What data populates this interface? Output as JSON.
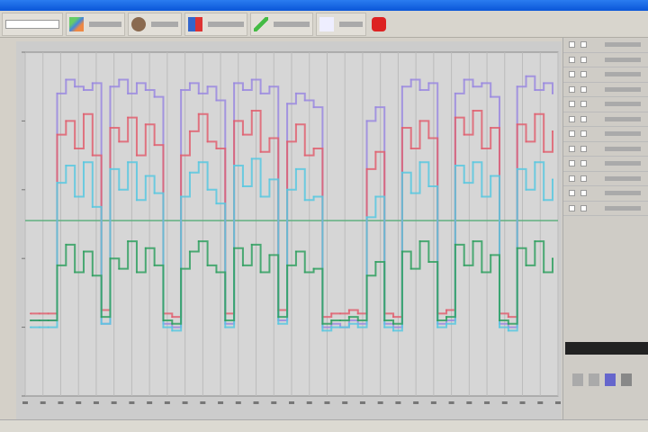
{
  "toolbar": {
    "buttons": [
      {
        "label": "",
        "icon": "chart-add-icon"
      },
      {
        "label": "",
        "icon": "settings-gear-icon"
      },
      {
        "label": "",
        "icon": "channel-graph-icon"
      },
      {
        "label": "",
        "icon": "curve-icon"
      },
      {
        "label": "",
        "icon": "document-icon"
      },
      {
        "label": "",
        "icon": "stop-icon"
      }
    ]
  },
  "colors": {
    "purple": "#9a88e0",
    "red": "#e06070",
    "cyan": "#58c8e0",
    "green": "#30a060",
    "ref": "#60b080"
  },
  "chart_data": {
    "type": "line",
    "title": "",
    "xlabel": "",
    "ylabel": "",
    "ylim": [
      0,
      100
    ],
    "grid": true,
    "x": [
      0,
      1,
      2,
      3,
      4,
      5,
      6,
      7,
      8,
      9,
      10,
      11,
      12,
      13,
      14,
      15,
      16,
      17,
      18,
      19,
      20,
      21,
      22,
      23,
      24,
      25,
      26,
      27,
      28,
      29,
      30,
      31,
      32,
      33,
      34,
      35,
      36,
      37,
      38,
      39,
      40,
      41,
      42,
      43,
      44,
      45,
      46,
      47,
      48,
      49,
      50,
      51,
      52,
      53,
      54,
      55,
      56,
      57,
      58,
      59
    ],
    "reference_line": 51,
    "series": [
      {
        "name": "purple",
        "color": "#9a88e0",
        "values": [
          22,
          22,
          22,
          88,
          92,
          90,
          89,
          91,
          21,
          90,
          92,
          88,
          91,
          89,
          87,
          21,
          20,
          89,
          91,
          88,
          90,
          86,
          21,
          91,
          89,
          92,
          88,
          90,
          22,
          85,
          88,
          86,
          84,
          20,
          21,
          20,
          22,
          21,
          80,
          84,
          21,
          20,
          90,
          92,
          89,
          91,
          21,
          22,
          88,
          92,
          90,
          91,
          87,
          21,
          20,
          90,
          93,
          89,
          91,
          88
        ]
      },
      {
        "name": "red",
        "color": "#e06070",
        "values": [
          24,
          24,
          24,
          76,
          80,
          72,
          82,
          70,
          25,
          78,
          74,
          81,
          70,
          79,
          73,
          24,
          23,
          70,
          77,
          82,
          74,
          72,
          24,
          80,
          76,
          83,
          71,
          75,
          25,
          74,
          79,
          70,
          72,
          23,
          24,
          24,
          25,
          24,
          66,
          71,
          24,
          23,
          78,
          72,
          80,
          75,
          24,
          25,
          81,
          76,
          83,
          72,
          78,
          24,
          23,
          79,
          74,
          82,
          71,
          77
        ]
      },
      {
        "name": "cyan",
        "color": "#58c8e0",
        "values": [
          20,
          20,
          20,
          62,
          67,
          58,
          68,
          55,
          21,
          66,
          60,
          68,
          57,
          64,
          59,
          20,
          19,
          58,
          65,
          68,
          60,
          56,
          20,
          67,
          61,
          69,
          58,
          63,
          21,
          60,
          66,
          57,
          58,
          19,
          20,
          20,
          21,
          20,
          52,
          58,
          20,
          19,
          65,
          59,
          68,
          61,
          20,
          21,
          67,
          62,
          68,
          58,
          64,
          20,
          19,
          66,
          60,
          68,
          57,
          63
        ]
      },
      {
        "name": "green",
        "color": "#30a060",
        "values": [
          22,
          22,
          22,
          38,
          44,
          36,
          42,
          35,
          23,
          40,
          37,
          45,
          36,
          43,
          38,
          22,
          21,
          37,
          42,
          45,
          38,
          36,
          22,
          43,
          38,
          44,
          36,
          41,
          23,
          38,
          42,
          36,
          37,
          21,
          22,
          22,
          23,
          22,
          35,
          39,
          22,
          21,
          42,
          37,
          45,
          39,
          22,
          23,
          44,
          38,
          45,
          36,
          41,
          22,
          21,
          43,
          38,
          45,
          36,
          40
        ]
      }
    ]
  },
  "readout": "",
  "status": ""
}
